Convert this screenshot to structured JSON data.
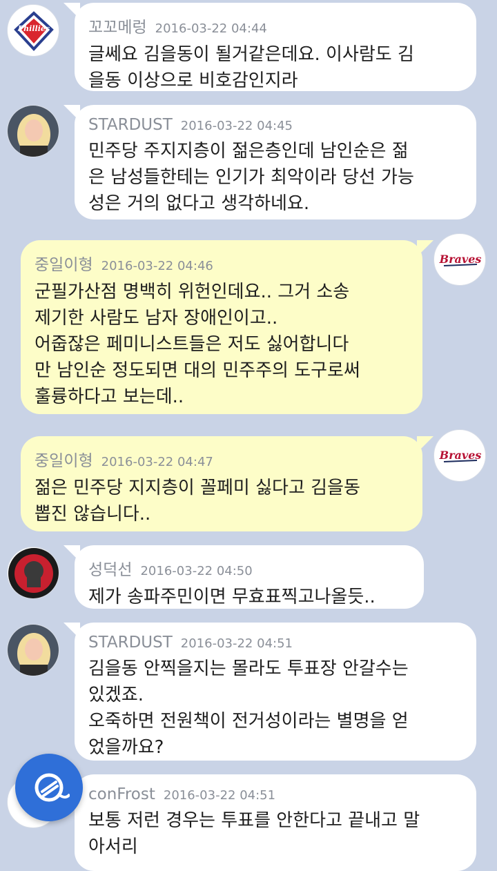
{
  "messages": [
    {
      "name": "꼬꼬메렁",
      "time": "2016-03-22 04:44",
      "text": "글쎄요 김을동이 될거같은데요. 이사람도 김\n을동 이상으로 비호감인지라",
      "side": "left",
      "avatar": "phillies-logo"
    },
    {
      "name": "STARDUST",
      "time": "2016-03-22 04:45",
      "text": "민주당 주지지층이 젊은층인데 남인순은 젊\n은 남성들한테는 인기가 최악이라 당선 가능\n성은 거의 없다고 생각하네요.",
      "side": "left",
      "avatar": "blonde-woman-photo"
    },
    {
      "name": "중일이형",
      "time": "2016-03-22 04:46",
      "text": "군필가산점 명백히 위헌인데요.. 그거 소송\n제기한 사람도 남자 장애인이고..\n어줍잖은 페미니스트들은 저도 싫어합니다\n만 남인순 정도되면 대의 민주주의 도구로써\n훌륭하다고 보는데..",
      "side": "right",
      "avatar": "braves-logo"
    },
    {
      "name": "중일이형",
      "time": "2016-03-22 04:47",
      "text": "젊은 민주당 지지층이 꼴페미 싫다고 김을동\n뽑진 않습니다..",
      "side": "right",
      "avatar": "braves-logo"
    },
    {
      "name": "성덕선",
      "time": "2016-03-22 04:50",
      "text": "제가 송파주민이면 무효표찍고나올듯..",
      "side": "left",
      "avatar": "lg-twins-logo"
    },
    {
      "name": "STARDUST",
      "time": "2016-03-22 04:51",
      "text": "김을동 안찍을지는 몰라도 투표장 안갈수는\n있겠죠.\n오죽하면 전원책이 전거성이라는 별명을 얻\n었을까요?",
      "side": "left",
      "avatar": "blonde-woman-photo"
    },
    {
      "name": "conFrost",
      "time": "2016-03-22 04:51",
      "text": "보통 저런 경우는 투표를 안한다고 끝내고 말\n아서리",
      "side": "left",
      "avatar": "default-avatar"
    }
  ],
  "logos": {
    "phillies": "Phillies",
    "braves": "Braves"
  },
  "colors": {
    "background": "#c9d3e6",
    "left_bubble": "#ffffff",
    "right_bubble": "#fdfdc8",
    "fab": "#2f6fd8"
  },
  "fab_icon": "app-logo-icon"
}
